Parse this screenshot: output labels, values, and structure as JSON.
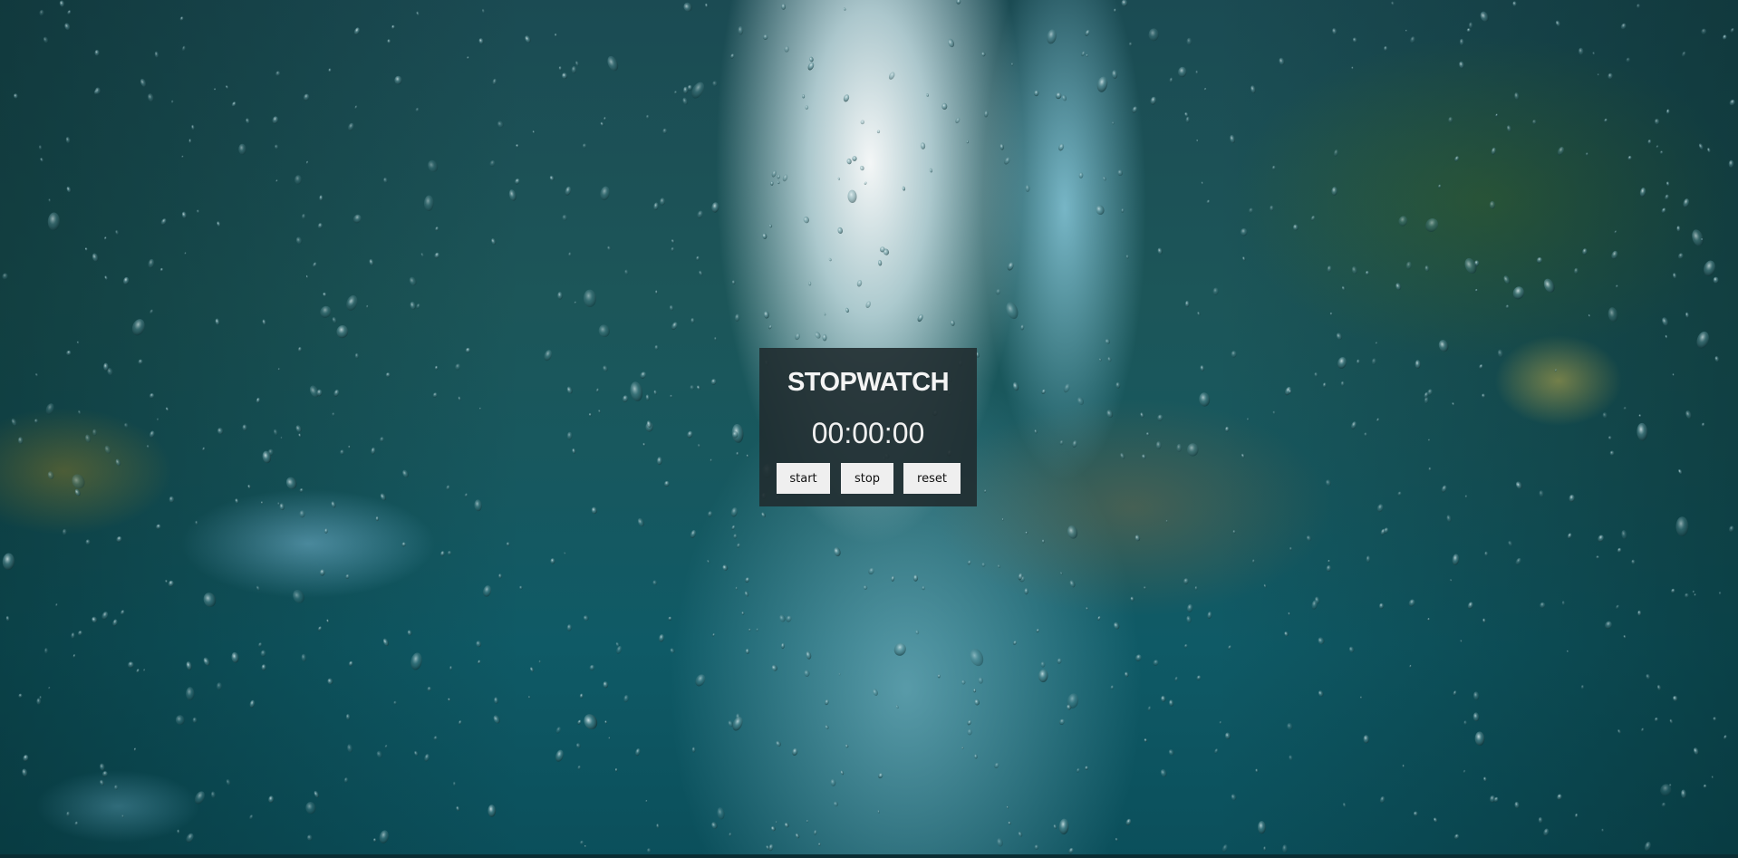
{
  "stopwatch": {
    "title": "STOPWATCH",
    "time": "00:00:00",
    "buttons": {
      "start": "start",
      "stop": "stop",
      "reset": "reset"
    }
  },
  "background": {
    "description_icon": "rainy-city-street-image"
  },
  "colors": {
    "panel": "#202c30",
    "button": "#efefef",
    "text": "#f4f4f4"
  }
}
